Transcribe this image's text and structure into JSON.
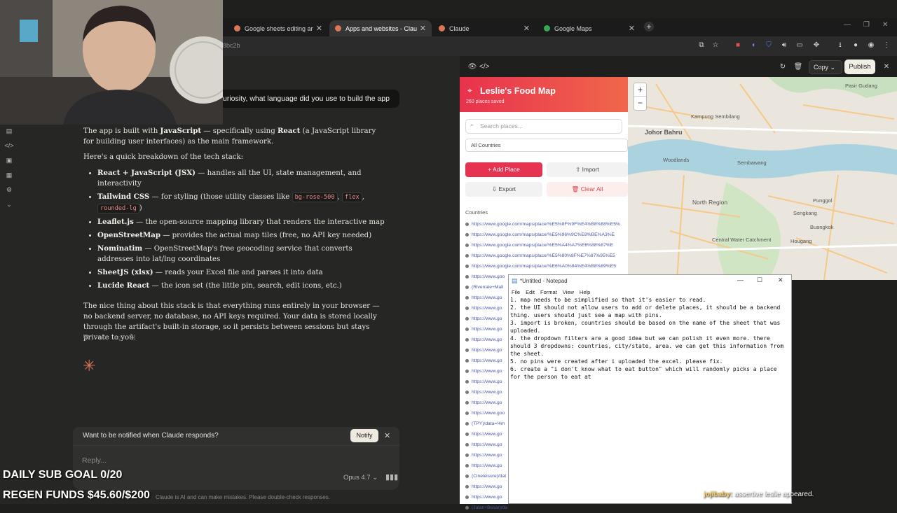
{
  "browser": {
    "tabs": [
      {
        "label": "Google sheets editing and map",
        "active": false,
        "favicon_color": "#d97757"
      },
      {
        "label": "Apps and websites - Claude",
        "active": true,
        "favicon_color": "#d97757"
      },
      {
        "label": "Claude",
        "active": false,
        "favicon_color": "#d97757"
      },
      {
        "label": "Google Maps",
        "active": false,
        "favicon_color": "#34a853"
      }
    ],
    "url_fragment": "8bc2b"
  },
  "chat": {
    "user_question": "uriosity, what language did you use to build the app",
    "intro_pre": "The app is built with ",
    "intro_b1": "JavaScript",
    "intro_mid": " — specifically using ",
    "intro_b2": "React",
    "intro_post": " (a JavaScript library for building user interfaces) as the main framework.",
    "breakdown": "Here's a quick breakdown of the tech stack:",
    "stack": [
      {
        "name": "React + JavaScript (JSX)",
        "desc": " — handles all the UI, state management, and interactivity"
      },
      {
        "name": "Tailwind CSS",
        "desc": " — for styling (those utility classes like "
      },
      {
        "name": "Leaflet.js",
        "desc": " — the open-source mapping library that renders the interactive map"
      },
      {
        "name": "OpenStreetMap",
        "desc": " — provides the actual map tiles (free, no API key needed)"
      },
      {
        "name": "Nominatim",
        "desc": " — OpenStreetMap's free geocoding service that converts addresses into lat/lng coordinates"
      },
      {
        "name": "SheetJS (xlsx)",
        "desc": " — reads your Excel file and parses it into data"
      },
      {
        "name": "Lucide React",
        "desc": " — the icon set (the little pin, search, edit icons, etc.)"
      }
    ],
    "code1": "bg-rose-500",
    "code2": "flex",
    "code3": "rounded-lg",
    "sep1": ", ",
    "sep2": ", ",
    "close": ")",
    "closing": "The nice thing about this stack is that everything runs entirely in your browser — no backend server, no database, no API keys required. Your data is stored locally through the artifact's built-in storage, so it persists between sessions but stays private to you.",
    "notify_text": "Want to be notified when Claude responds?",
    "notify_button": "Notify",
    "reply_placeholder": "Reply...",
    "model": "Opus 4.7",
    "disclaimer": "Claude is AI and can make mistakes. Please double-check responses."
  },
  "overlay": {
    "sub_goal": "DAILY SUB GOAL 0/20",
    "funds": "REGEN FUNDS $45.60/$200",
    "chat_user": "jojibaby:",
    "chat_text": " assertive leslie appeared."
  },
  "artifact": {
    "copy": "Copy",
    "publish": "Publish"
  },
  "foodmap": {
    "title": "Leslie's Food Map",
    "count": "260 places saved",
    "search_placeholder": "Search places...",
    "country_select": "All Countries",
    "add": "+ Add Place",
    "import": "⇧ Import",
    "export": "⇩ Export",
    "clear": "🗑 Clear All",
    "countries_label": "Countries",
    "items": [
      "https://www.google.com/maps/place/%E5%8F%9F%E4%B8%88%E5%",
      "https://www.google.com/maps/place/%E5%96%9C%E8%BE%A3%E",
      "https://www.google.com/maps/place/%E5%A4%A7%E6%88%87%E",
      "https://www.google.com/maps/place/%E5%80%8F%E7%87%95%E5",
      "https://www.google.com/maps/place/%E6%A0%84%E4%B8%89%E5",
      "https://www.goo",
      "(Riverrale+Mall",
      "https://www.go",
      "https://www.go",
      "https://www.go",
      "https://www.go",
      "https://www.go",
      "https://www.go",
      "https://www.go",
      "https://www.go",
      "https://www.go",
      "https://www.go",
      "https://www.go",
      "https://www.goo",
      "(TPY)/data=!4m",
      "https://www.go",
      "https://www.go",
      "https://www.go",
      "https://www.go",
      "(Cineleisure)/dat",
      "https://www.go",
      "https://www.go",
      "(Jalan+Besar)/da"
    ]
  },
  "map": {
    "labels": [
      "Pasir Gudang",
      "Kampung Sembilang",
      "Johor Bahru",
      "Woodlands",
      "Sembawang",
      "North Region",
      "Sengkang",
      "Punggol",
      "Buangkok",
      "Hougang",
      "Central Water Catchment"
    ],
    "zoom_in": "+",
    "zoom_out": "−"
  },
  "notepad": {
    "title": "*Untitled - Notepad",
    "menu": [
      "File",
      "Edit",
      "Format",
      "View",
      "Help"
    ],
    "body": "1. map needs to be simplified so that it's easier to read.\n2. the UI should not allow users to add or delete places, it should be a backend thing. users should just see a map with pins.\n3. import is broken, countries should be based on the name of the sheet that was uploaded.\n4. the dropdown filters are a good idea but we can polish it even more. there should 3 dropdowns: countries, city/state, area. we can get this information from the sheet.\n5. no pins were created after i uploaded the excel. please fix.\n6. create a \"i don't know what to eat button\" which will randomly picks a place for the person to eat at"
  },
  "colors": {
    "accent": "#d97757",
    "brand_red": "#e53351",
    "bg": "#262624"
  }
}
